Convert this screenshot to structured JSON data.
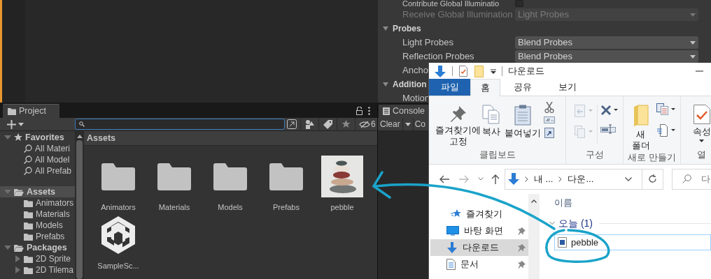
{
  "inspector": {
    "rows": [
      {
        "kind": "checkbox",
        "label": "Contribute Global Illuminatio",
        "checked": false
      },
      {
        "kind": "dropdown",
        "label": "Receive Global Illumination",
        "value": "Light Probes",
        "disabled": true
      },
      {
        "kind": "foldout",
        "label": "Probes",
        "expanded": true
      },
      {
        "kind": "dropdown",
        "label": "Light Probes",
        "value": "Blend Probes",
        "disabled": false
      },
      {
        "kind": "dropdown",
        "label": "Reflection Probes",
        "value": "Blend Probes",
        "disabled": false
      },
      {
        "kind": "label",
        "label": "Ancho"
      },
      {
        "kind": "foldout",
        "label": "Addition",
        "expanded": true
      },
      {
        "kind": "label",
        "label": "Motion"
      }
    ]
  },
  "project": {
    "tab": "Project",
    "filter_count": "6",
    "tree": [
      {
        "label": "Favorites",
        "kind": "favorites",
        "expanded": true,
        "selected": false,
        "children": [
          {
            "label": "All Materi",
            "kind": "search",
            "selected": false
          },
          {
            "label": "All Model",
            "kind": "search",
            "selected": false
          },
          {
            "label": "All Prefab",
            "kind": "search",
            "selected": false
          }
        ]
      },
      {
        "label": "Assets",
        "kind": "folder",
        "expanded": true,
        "selected": true,
        "children": [
          {
            "label": "Animators",
            "kind": "folder",
            "selected": false
          },
          {
            "label": "Materials",
            "kind": "folder",
            "selected": false
          },
          {
            "label": "Models",
            "kind": "folder",
            "selected": false
          },
          {
            "label": "Prefabs",
            "kind": "folder",
            "selected": false
          }
        ]
      },
      {
        "label": "Packages",
        "kind": "folder",
        "expanded": true,
        "selected": false,
        "children": [
          {
            "label": "2D Sprite",
            "kind": "folder",
            "expanded": false,
            "selected": false
          },
          {
            "label": "2D Tilema",
            "kind": "folder",
            "expanded": false,
            "selected": false
          }
        ]
      }
    ],
    "breadcrumb": "Assets",
    "items": [
      {
        "label": "Animators",
        "kind": "folder"
      },
      {
        "label": "Materials",
        "kind": "folder"
      },
      {
        "label": "Models",
        "kind": "folder"
      },
      {
        "label": "Prefabs",
        "kind": "folder"
      },
      {
        "label": "pebble",
        "kind": "image"
      },
      {
        "label": "SampleSc...",
        "kind": "scene"
      }
    ]
  },
  "console": {
    "tab": "Console",
    "clear": "Clear",
    "collapse": "Co"
  },
  "explorer": {
    "title": "다운로드",
    "ribbon_tabs": [
      {
        "label": "파일",
        "kind": "file",
        "selected": false
      },
      {
        "label": "홈",
        "kind": "tab",
        "selected": true
      },
      {
        "label": "공유",
        "kind": "tab",
        "selected": false
      },
      {
        "label": "보기",
        "kind": "tab",
        "selected": false
      }
    ],
    "ribbon_groups": [
      {
        "label": "클립보드",
        "commands": [
          "즐겨찾기에 고정",
          "복사",
          "붙여넣기"
        ]
      },
      {
        "label": "구성"
      },
      {
        "label": "새로 만들기",
        "commands": [
          "새 폴더"
        ]
      },
      {
        "label": "열",
        "commands": [
          "속성"
        ]
      }
    ],
    "address": {
      "segments": [
        "내 ...",
        "다운..."
      ],
      "search_placeholder": "다"
    },
    "nav": [
      {
        "label": "즐겨찾기",
        "selected": false,
        "children": [
          {
            "label": "바탕 화면",
            "pinned": true,
            "selected": false
          },
          {
            "label": "다운로드",
            "pinned": true,
            "selected": true
          },
          {
            "label": "문서",
            "pinned": true,
            "selected": false
          }
        ]
      }
    ],
    "content": {
      "column": "이름",
      "groups": [
        {
          "label": "오늘 (1)",
          "expanded": true,
          "files": [
            "pebble"
          ]
        }
      ]
    }
  }
}
